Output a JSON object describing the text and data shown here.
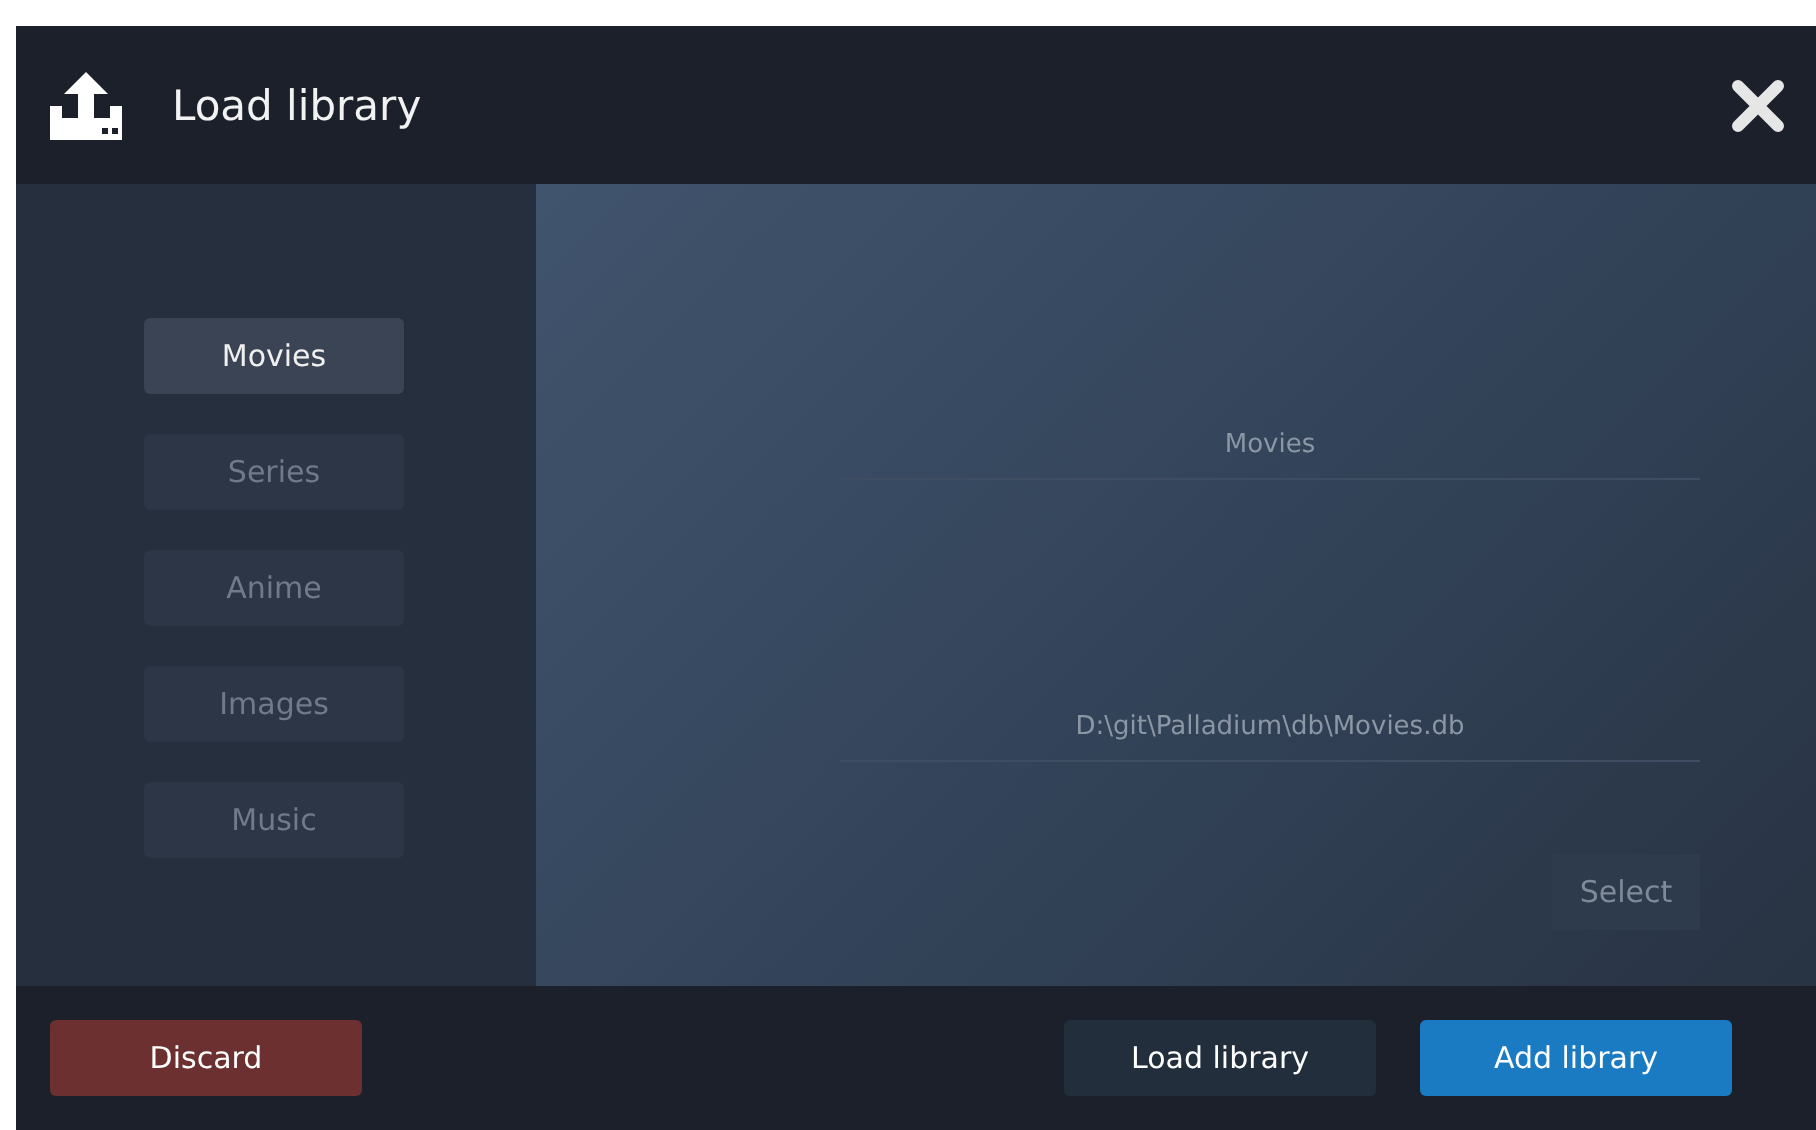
{
  "window": {
    "title": "Load library"
  },
  "categories": [
    {
      "label": "Movies",
      "selected": true
    },
    {
      "label": "Series",
      "selected": false
    },
    {
      "label": "Anime",
      "selected": false
    },
    {
      "label": "Images",
      "selected": false
    },
    {
      "label": "Music",
      "selected": false
    }
  ],
  "form": {
    "name": {
      "value": "Movies"
    },
    "path": {
      "value": "D:\\git\\Palladium\\db\\Movies.db"
    },
    "select_button": "Select"
  },
  "footer_buttons": [
    {
      "label": "Discard",
      "kind": "danger"
    },
    {
      "label": "Load library",
      "kind": "secondary"
    },
    {
      "label": "Add library",
      "kind": "primary"
    }
  ]
}
